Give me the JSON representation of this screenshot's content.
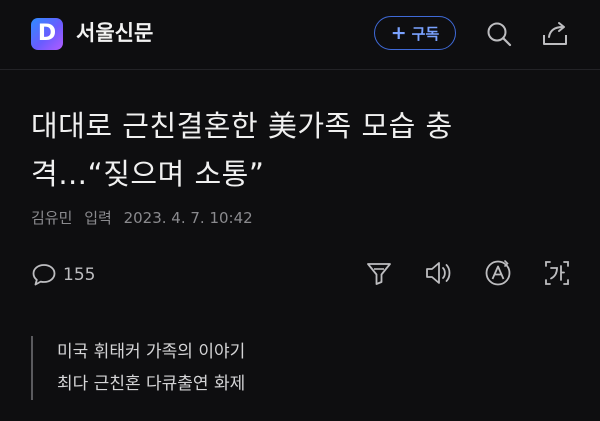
{
  "header": {
    "logo_letter": "D",
    "brand": "서울신문",
    "subscribe_plus": "+",
    "subscribe_label": "구독"
  },
  "article": {
    "headline_line1": "대대로 근친결혼한 美가족 모습 충",
    "headline_line2": "격…“짖으며 소통”",
    "author": "김유민",
    "published_label": "입력",
    "published_time": "2023. 4. 7. 10:42",
    "comment_count": "155"
  },
  "summary": {
    "lines": [
      "미국 휘태커 가족의 이야기",
      "최다 근친혼 다큐출연 화제"
    ]
  },
  "colors": {
    "background": "#0e0e10",
    "accent": "#3f6ad8",
    "text": "#ececec"
  },
  "icons": [
    "search-icon",
    "share-icon",
    "comment-icon",
    "summary-icon",
    "listen-icon",
    "font-size-icon",
    "translate-icon"
  ]
}
